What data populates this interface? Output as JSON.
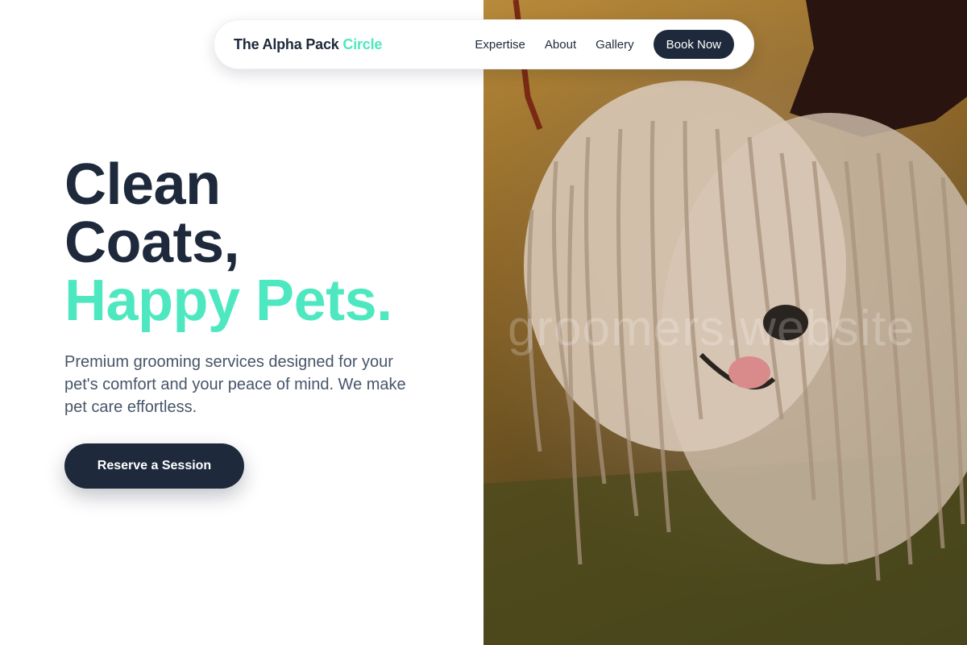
{
  "nav": {
    "brand_main": "The Alpha Pack",
    "brand_accent": "Circle",
    "links": [
      "Expertise",
      "About",
      "Gallery"
    ],
    "cta": "Book Now"
  },
  "hero": {
    "line1": "Clean",
    "line2": "Coats,",
    "line3": "Happy Pets.",
    "subtext": "Premium grooming services designed for your pet's comfort and your peace of mind. We make pet care effortless.",
    "cta": "Reserve a Session"
  },
  "photo": {
    "watermark": "groomers.website",
    "subject": "corded-dog-photo"
  },
  "colors": {
    "primary": "#1e2a3b",
    "accent": "#4ee8c0",
    "text_muted": "#475569"
  }
}
